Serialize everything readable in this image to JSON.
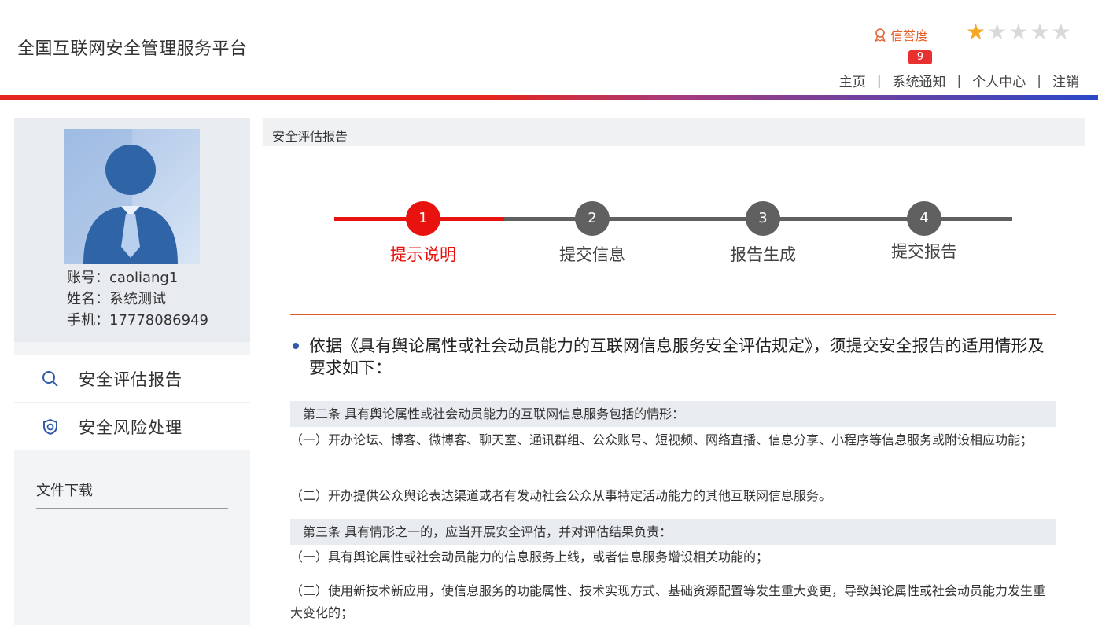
{
  "header": {
    "site_title": "全国互联网安全管理服务平台",
    "credit_label": "信誉度",
    "stars_filled": 1,
    "stars_total": 5,
    "notification_count": "9",
    "nav": {
      "home": "主页",
      "notifications": "系统通知",
      "personal_center": "个人中心",
      "logout": "注销",
      "separator": "|"
    }
  },
  "colors": {
    "accent_red": "#e8130f",
    "divider": "#e15a36",
    "star_on": "#f5a623",
    "credit_orange": "#e8602c"
  },
  "profile": {
    "account": "账号：caoliang1",
    "name": "姓名：系统测试",
    "phone": "手机：17778086949"
  },
  "sidebar": {
    "items": [
      {
        "label": "安全评估报告",
        "icon": "search-icon"
      },
      {
        "label": "安全风险处理",
        "icon": "shield-icon"
      }
    ],
    "downloads": "文件下载"
  },
  "main": {
    "panel_title": "安全评估报告",
    "steps": [
      {
        "num": "1",
        "label": "提示说明",
        "state": "active"
      },
      {
        "num": "2",
        "label": "提交信息",
        "state": "todo"
      },
      {
        "num": "3",
        "label": "报告生成",
        "state": "todo"
      },
      {
        "num": "4",
        "label": "提交报告",
        "state": "todo"
      }
    ],
    "intro": "依据《具有舆论属性或社会动员能力的互联网信息服务安全评估规定》，须提交安全报告的适用情形及要求如下：",
    "article2_head": "第二条 具有舆论属性或社会动员能力的互联网信息服务包括的情形：",
    "article2_p1": "（一）开办论坛、博客、微博客、聊天室、通讯群组、公众账号、短视频、网络直播、信息分享、小程序等信息服务或附设相应功能；",
    "article2_p2": "（二）开办提供公众舆论表达渠道或者有发动社会公众从事特定活动能力的其他互联网信息服务。",
    "article3_head": "第三条 具有情形之一的，应当开展安全评估，并对评估结果负责：",
    "article3_p1": "（一）具有舆论属性或社会动员能力的信息服务上线，或者信息服务增设相关功能的；",
    "article3_p2": "（二）使用新技术新应用，使信息服务的功能属性、技术实现方式、基础资源配置等发生重大变更，导致舆论属性或社会动员能力发生重大变化的；"
  }
}
